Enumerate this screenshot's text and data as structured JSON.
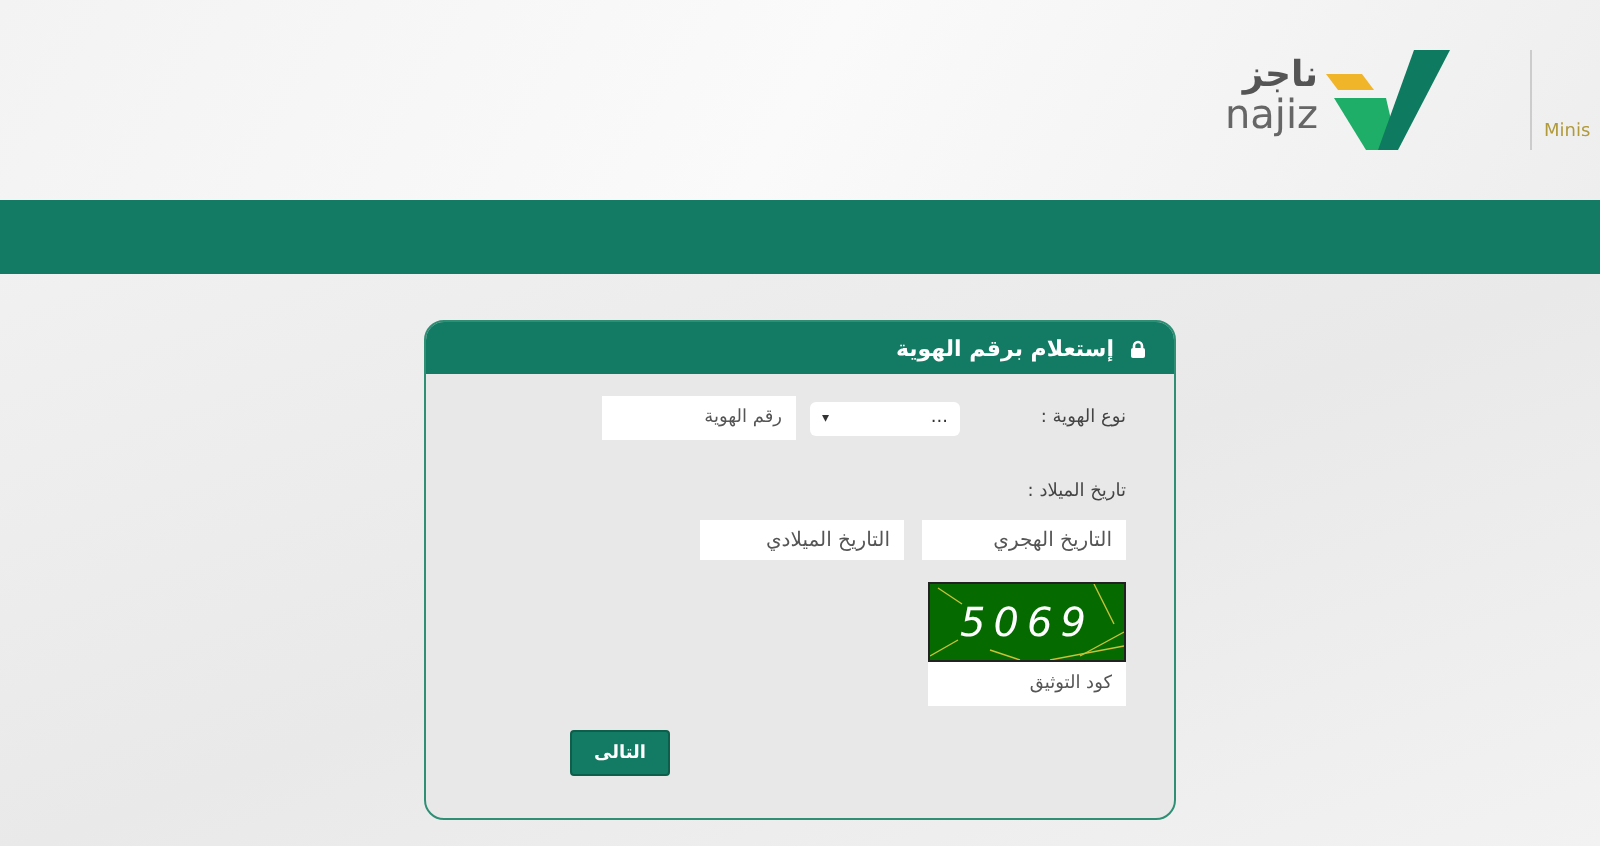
{
  "header": {
    "logo_arabic": "ناجز",
    "logo_latin": "najiz",
    "ministry_text": "Minis"
  },
  "form": {
    "title": "إستعلام برقم الهوية",
    "id_type": {
      "label": "نوع الهوية :",
      "value": "...",
      "arrow": "▾"
    },
    "id_number": {
      "placeholder": "رقم الهوية"
    },
    "birth_label": "تاريخ الميلاد :",
    "date_fields": [
      {
        "placeholder": "التاريخ الهجري"
      },
      {
        "placeholder": "التاريخ الميلادي"
      }
    ],
    "captcha": {
      "code": "5069",
      "placeholder": "كود التوثيق"
    },
    "next_button": "التالى"
  }
}
